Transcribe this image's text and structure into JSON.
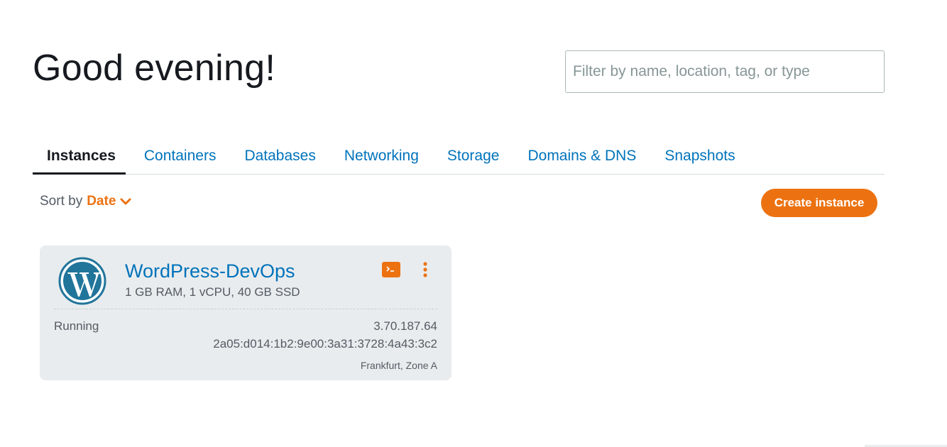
{
  "header": {
    "greeting": "Good evening!",
    "filter_placeholder": "Filter by name, location, tag, or type"
  },
  "tabs": [
    {
      "label": "Instances",
      "active": true
    },
    {
      "label": "Containers",
      "active": false
    },
    {
      "label": "Databases",
      "active": false
    },
    {
      "label": "Networking",
      "active": false
    },
    {
      "label": "Storage",
      "active": false
    },
    {
      "label": "Domains & DNS",
      "active": false
    },
    {
      "label": "Snapshots",
      "active": false
    }
  ],
  "toolbar": {
    "sort_label": "Sort by",
    "sort_value": "Date",
    "create_label": "Create instance"
  },
  "instance": {
    "name": "WordPress-DevOps",
    "spec": "1 GB RAM, 1 vCPU, 40 GB SSD",
    "status": "Running",
    "ipv4": "3.70.187.64",
    "ipv6": "2a05:d014:1b2:9e00:3a31:3728:4a43:3c2",
    "location": "Frankfurt, Zone A",
    "icon": "wordpress-icon"
  },
  "colors": {
    "accent": "#ec7211",
    "link": "#0073bb",
    "wordpress": "#21759b",
    "card_bg": "#e9ecee"
  }
}
